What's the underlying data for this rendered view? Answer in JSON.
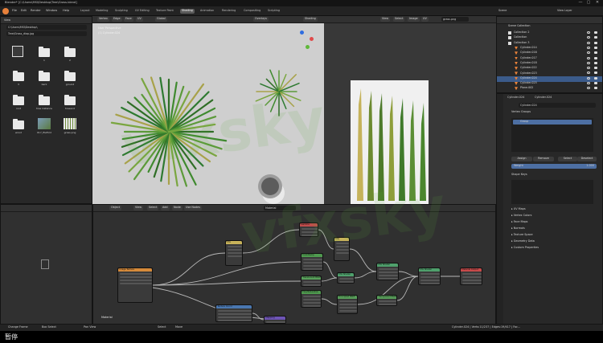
{
  "window": {
    "title": "Blender* [C:\\Users\\MSI\\Desktop\\Tree\\Grass.blend]",
    "controls": [
      "—",
      "▢",
      "✕"
    ]
  },
  "menu": {
    "items": [
      "File",
      "Edit",
      "Render",
      "Window",
      "Help"
    ]
  },
  "workspaces": [
    "Layout",
    "Modeling",
    "Sculpting",
    "UV Editing",
    "Texture Paint",
    "Shading",
    "Animation",
    "Rendering",
    "Compositing",
    "Scripting"
  ],
  "active_workspace": "Shading",
  "scene": {
    "label": "Scene",
    "view_layer": "View Layer"
  },
  "file_browser": {
    "view_label": "View",
    "path": "C:\\Users\\MSI\\Desktop\\",
    "filename": "Tree\\Grass_diap.jpg",
    "items": [
      {
        "name": "",
        "kind": "parent"
      },
      {
        "name": "1",
        "kind": "folder"
      },
      {
        "name": "2",
        "kind": "folder"
      },
      {
        "name": "3",
        "kind": "folder"
      },
      {
        "name": "bark",
        "kind": "folder"
      },
      {
        "name": "ground",
        "kind": "folder"
      },
      {
        "name": "root",
        "kind": "folder"
      },
      {
        "name": "tree instance",
        "kind": "folder"
      },
      {
        "name": "treeend",
        "kind": "folder"
      },
      {
        "name": "wood",
        "kind": "folder"
      },
      {
        "name": "017_fileFold",
        "kind": "image"
      },
      {
        "name": "grass.png",
        "kind": "image"
      }
    ]
  },
  "viewport": {
    "menus": [
      "Vertex",
      "Edge",
      "Face",
      "UV"
    ],
    "transform": "Global",
    "overlay": "Overlays",
    "shading": "Shading",
    "info_line1": "User Perspective",
    "info_line2": "(1) Cylinder.024"
  },
  "image_editor": {
    "menus": [
      "View",
      "Select",
      "Image",
      "UV"
    ],
    "image_name": "grass.png"
  },
  "outliner": {
    "root": "Scene Collection",
    "items": [
      "Collection 2",
      "Collection",
      "Collection 3",
      "Cylinder.014",
      "Cylinder.016",
      "Cylinder.017",
      "Cylinder.018",
      "Cylinder.022",
      "Cylinder.023",
      "Cylinder.024",
      "Cylinder.025",
      "Plane.002"
    ],
    "selected": "Cylinder.024"
  },
  "properties": {
    "breadcrumb": [
      "Cylinder.024",
      "Cylinder.024"
    ],
    "object_name": "Cylinder.024",
    "vertex_groups": {
      "title": "Vertex Groups",
      "group": "Group"
    },
    "vg_buttons": [
      "Assign",
      "Remove",
      "Select",
      "Deselect"
    ],
    "weight_label": "Weight",
    "weight_value": "1.000",
    "shape_keys": "Shape Keys",
    "sections": [
      "UV Maps",
      "Vertex Colors",
      "Face Maps",
      "Normals",
      "Texture Space",
      "Geometry Data",
      "Custom Properties"
    ]
  },
  "node_editor": {
    "header": [
      "Object",
      "View",
      "Select",
      "Add",
      "Node"
    ],
    "use_nodes": "Use Nodes",
    "material": "Material",
    "slot": "Slot 1",
    "footer_label": "Material",
    "nodes": [
      {
        "title": "Image Texture",
        "color": "#d68a3a"
      },
      {
        "title": "Mix",
        "color": "#c8b35a"
      },
      {
        "title": "Mix",
        "color": "#c8b35a"
      },
      {
        "title": "Gamma",
        "color": "#c14c4c"
      },
      {
        "title": "ColorRamp",
        "color": "#4f9b4f"
      },
      {
        "title": "Hue/Saturation",
        "color": "#4f9b4f"
      },
      {
        "title": "Translucent BSDF",
        "color": "#58a05a"
      },
      {
        "title": "Mix Shader",
        "color": "#4fa06c"
      },
      {
        "title": "Mix Shader",
        "color": "#4fa06c"
      },
      {
        "title": "Principled BSDF",
        "color": "#58a05a"
      },
      {
        "title": "Transparent BSDF",
        "color": "#58a05a"
      },
      {
        "title": "Mix Shader",
        "color": "#4fa06c"
      },
      {
        "title": "Material Output",
        "color": "#c84a4a"
      },
      {
        "title": "Texture Coord",
        "color": "#4a77b0"
      },
      {
        "title": "Mapping",
        "color": "#6e54b5"
      }
    ]
  },
  "statusbar": {
    "left": [
      "Change Frame",
      "Box Select",
      "Pan View",
      "Select",
      "Move"
    ],
    "right": "Cylinder.024 | Verts:11/237 | Edges:19/417 | Fac..."
  },
  "subtitle": "暂停",
  "watermark": "vfxsky"
}
